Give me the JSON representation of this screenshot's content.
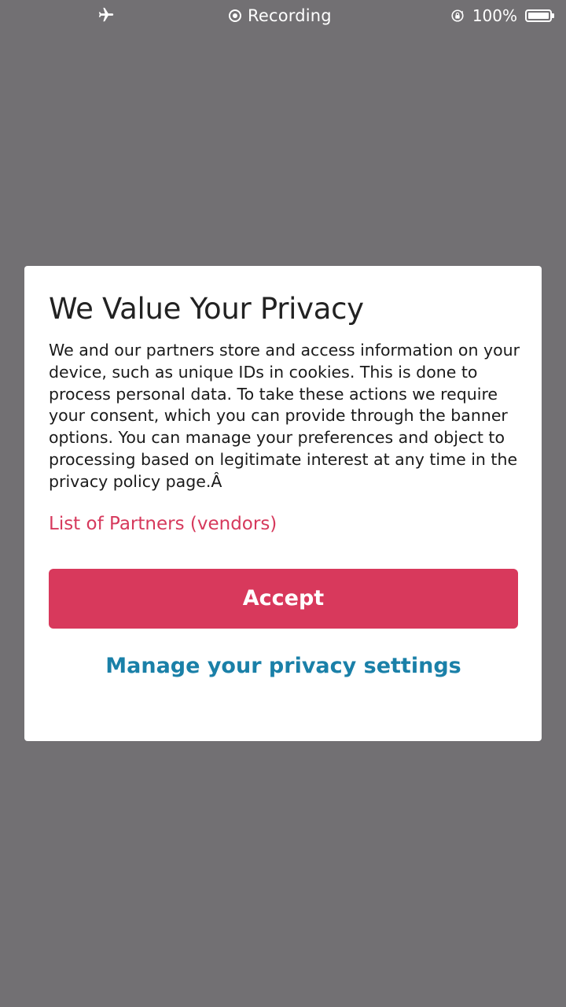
{
  "status_bar": {
    "airplane_icon": "airplane-icon",
    "recording_icon": "record-icon",
    "recording_label": "Recording",
    "rotation_lock_icon": "rotation-lock-icon",
    "battery_percent": "100%",
    "battery_icon": "battery-icon",
    "battery_level": 1.0
  },
  "dialog": {
    "title": "We Value Your Privacy",
    "body": "We and our partners store and access information on your device, such as unique IDs in cookies. This is done to process personal data. To take these actions we require your consent, which you can provide through the banner options. You can manage your preferences and object to processing based on legitimate interest at any time in the privacy policy page.Â",
    "vendors_link": "List of Partners (vendors)",
    "accept_label": "Accept",
    "manage_label": "Manage your privacy settings"
  },
  "colors": {
    "backdrop": "#727073",
    "accent": "#d8395c",
    "link_secondary": "#1a80a8",
    "dialog_background": "#ffffff"
  }
}
